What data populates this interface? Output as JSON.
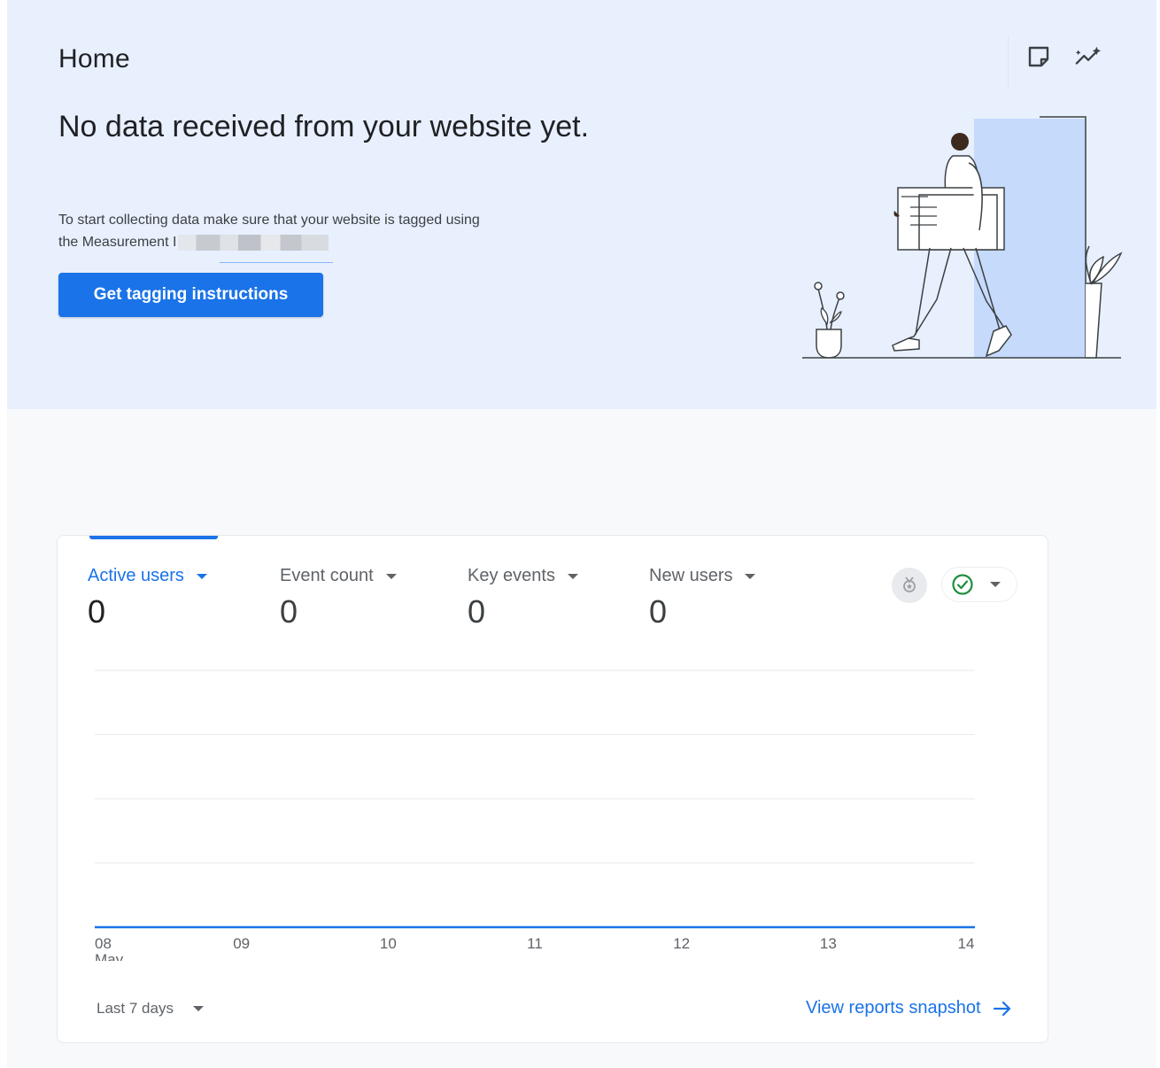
{
  "header": {
    "title": "Home",
    "icons": [
      "insights-note-icon",
      "trending-sparkle-icon"
    ]
  },
  "banner": {
    "headline": "No data received from your website yet.",
    "description_line1": "To start collecting data make sure that your website is tagged using",
    "description_line2": "the Measurement I",
    "button_label": "Get tagging instructions"
  },
  "metrics": [
    {
      "label": "Active users",
      "value": "0",
      "active": true
    },
    {
      "label": "Event count",
      "value": "0",
      "active": false
    },
    {
      "label": "Key events",
      "value": "0",
      "active": false
    },
    {
      "label": "New users",
      "value": "0",
      "active": false
    }
  ],
  "chart_data": {
    "type": "line",
    "x": [
      "08",
      "09",
      "10",
      "11",
      "12",
      "13",
      "14"
    ],
    "x_sublabel": "May",
    "series": [
      {
        "values": [
          0,
          0,
          0,
          0,
          0,
          0,
          0
        ]
      }
    ],
    "grid": true
  },
  "footer": {
    "date_range": "Last 7 days",
    "link_label": "View reports snapshot"
  },
  "colors": {
    "accent": "#1a73e8",
    "banner_bg": "#e8f0fe",
    "success": "#1e8e3e"
  }
}
